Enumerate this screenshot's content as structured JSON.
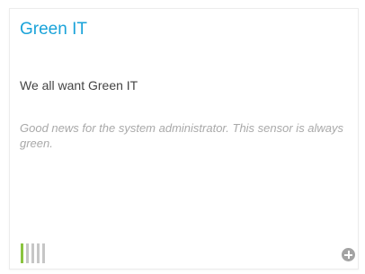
{
  "card": {
    "title": "Green IT",
    "subtitle": "We all want Green IT",
    "description": "Good news for the system administrator. This sensor is always green.",
    "status": {
      "active_bars": 1,
      "total_bars": 5,
      "active_color": "#8ac43f",
      "inactive_color": "#c6c6c6"
    },
    "add_icon": "plus-circle-icon"
  },
  "colors": {
    "title": "#1aa3d9",
    "text": "#444444",
    "muted": "#a9a9a9"
  }
}
